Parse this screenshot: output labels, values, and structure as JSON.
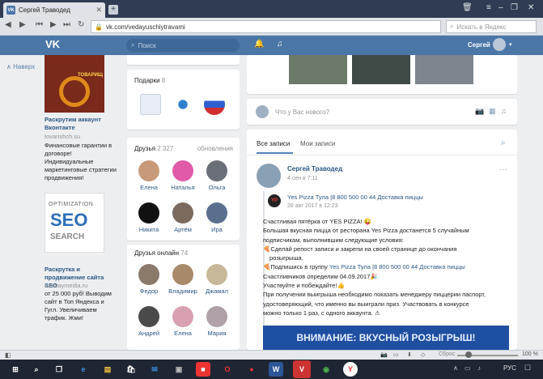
{
  "browser": {
    "tab_title": "Сергей Траводед",
    "tab_vk": "VK",
    "url": "vk.com/vedayuschiytravami",
    "search_placeholder": "Искать в Яндекс"
  },
  "vk_header": {
    "search_placeholder": "Поиск",
    "user_name": "Сергей"
  },
  "left_nav": {
    "back": "Наверх"
  },
  "ads": [
    {
      "badge": "ТОВАРИЩ",
      "title": "Раскрутим аккаунт Вконтакте",
      "site": "tovarishch.su",
      "text": "Финансовые гарантии в договоре! Индивидуальные маркетинговые стратегии продвижения!"
    },
    {
      "title": "Раскрутка и продвижение сайта SEO",
      "site": "runwaymedia.ru",
      "text": "от 25 000 руб! Выводим сайт в Топ Яндекса и Гугл. Увеличиваем трафик. Жми!",
      "img_top": "OPTIMIZATION",
      "img_main": "SEO",
      "img_bottom": "SEARCH"
    }
  ],
  "gifts": {
    "title": "Подарки",
    "count": "8"
  },
  "friends": {
    "title": "Друзья",
    "count": "2 327",
    "updates": "обновления",
    "items": [
      "Елена",
      "Наталья",
      "Ольга",
      "Никита",
      "Артём",
      "Ира"
    ]
  },
  "online": {
    "title": "Друзья онлайн",
    "count": "74",
    "items": [
      "Федор",
      "Владимир",
      "Джамал",
      "Андрей",
      "Елена",
      "Мария"
    ]
  },
  "composer": {
    "placeholder": "Что у Вас нового?"
  },
  "wall_tabs": {
    "all": "Все записи",
    "mine": "Мои записи"
  },
  "post": {
    "author": "Сергей Траводед",
    "date": "4 сен в 7:11",
    "more": "···",
    "repost_author": "Yes Pizza Тула |8 800 500 00 44 Доставка пиццы",
    "repost_date": "28 авг 2017 в 12:23",
    "lines": [
      "Счастливая пятёрка от YES PIZZA! 😜",
      "Большая вкусная пицца от ресторана Yes Pizza достанется 5 случайным",
      "подписчикам, выполнившим следующие условия:",
      "🍕Сделай репост записи и закрепи на своей странице до окончания",
      "розыгрыша.",
      "🍕Подпишись в группу",
      "Счастливчиков определим 04.09.2017🎉",
      "Участвуйте и побеждайте!👍",
      "При получении выигрыша необходимо показать менеджеру пиццерии паспорт,",
      "удостоверяющий, что именно вы выиграли приз. Участвовать в конкурсе",
      "можно только 1 раз, с одного аккаунта. ⚠"
    ],
    "group_link": "Yes Pizza Тула |8 800 500 00 44 Доставка пиццы",
    "banner": "ВНИМАНИЕ: ВКУСНЫЙ РОЗЫГРЫШ!"
  },
  "statusbar": {
    "reset": "Сброс",
    "zoom": "100 %"
  },
  "taskbar": {
    "lang": "РУС"
  },
  "colors": {
    "vk_blue": "#4a76a8",
    "link": "#2a5885",
    "bg": "#edeef0"
  }
}
